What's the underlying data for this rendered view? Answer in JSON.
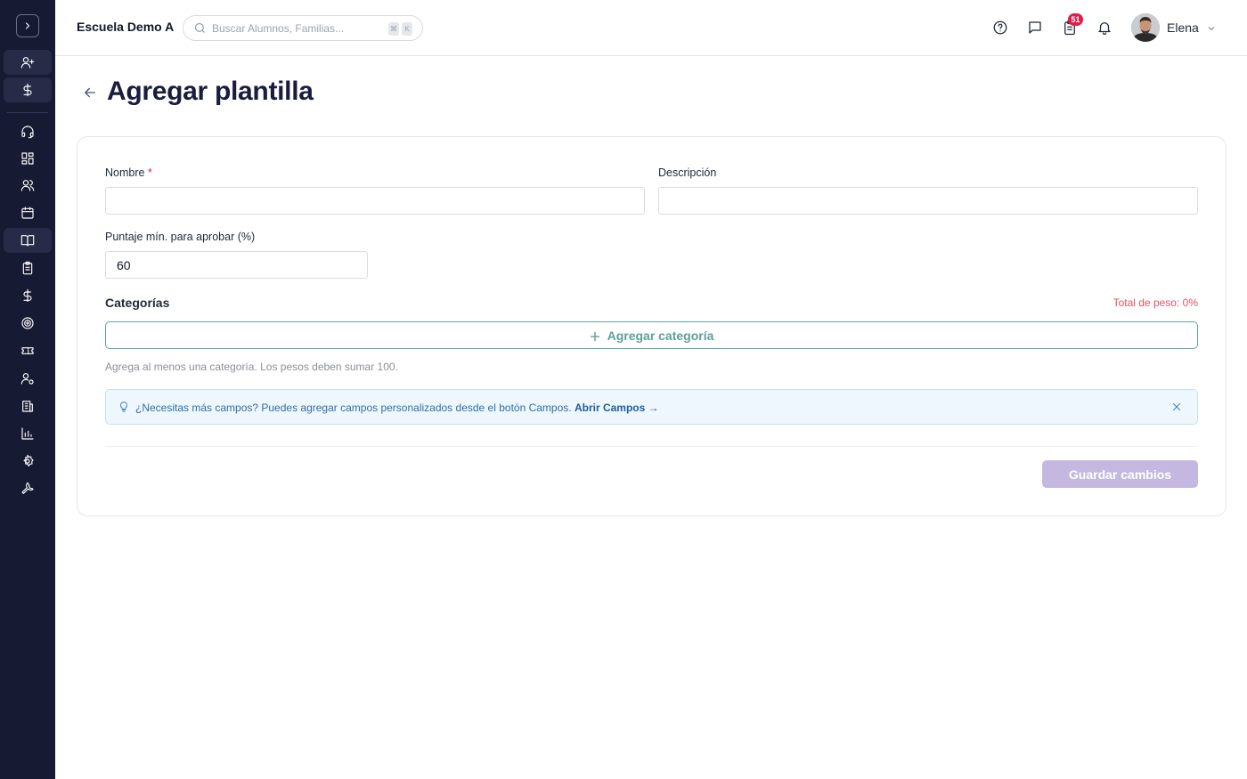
{
  "header": {
    "school_name": "Escuela Demo A",
    "search_placeholder": "Buscar Alumnos, Familias...",
    "search_shortcut": [
      "⌘",
      "K"
    ],
    "notification_count": "51",
    "user_name": "Elena"
  },
  "sidebar": {
    "items": [
      {
        "icon": "user-plus-icon"
      },
      {
        "icon": "dollar-icon"
      },
      {
        "icon": "headset-icon"
      },
      {
        "icon": "dashboard-icon"
      },
      {
        "icon": "users-icon"
      },
      {
        "icon": "calendar-icon"
      },
      {
        "icon": "book-open-icon",
        "active": true
      },
      {
        "icon": "clipboard-icon"
      },
      {
        "icon": "dollar-icon"
      },
      {
        "icon": "target-icon"
      },
      {
        "icon": "ticket-icon"
      },
      {
        "icon": "user-settings-icon"
      },
      {
        "icon": "building-icon"
      },
      {
        "icon": "bar-chart-icon"
      },
      {
        "icon": "gear-icon"
      },
      {
        "icon": "wrench-icon"
      }
    ]
  },
  "page": {
    "title": "Agregar plantilla"
  },
  "form": {
    "name_label": "Nombre",
    "name_required_mark": "*",
    "name_value": "",
    "description_label": "Descripción",
    "description_value": "",
    "min_score_label": "Puntaje mín. para aprobar (%)",
    "min_score_value": "60",
    "categories_title": "Categorías",
    "total_weight": "Total de peso: 0%",
    "add_category_label": "Agregar categoría",
    "help_text": "Agrega al menos una categoría. Los pesos deben sumar 100.",
    "tip_text": "¿Necesitas más campos? Puedes agregar campos personalizados desde el botón Campos.",
    "tip_link": "Abrir Campos →",
    "save_label": "Guardar cambios"
  },
  "colors": {
    "sidebar_bg": "#171a33",
    "title": "#191c3d",
    "accent_teal": "#5e9f9a",
    "save_disabled": "#c4b8e0",
    "badge": "#e11d48",
    "warning_red": "#e05260",
    "tip_bg": "#eef7fd"
  }
}
